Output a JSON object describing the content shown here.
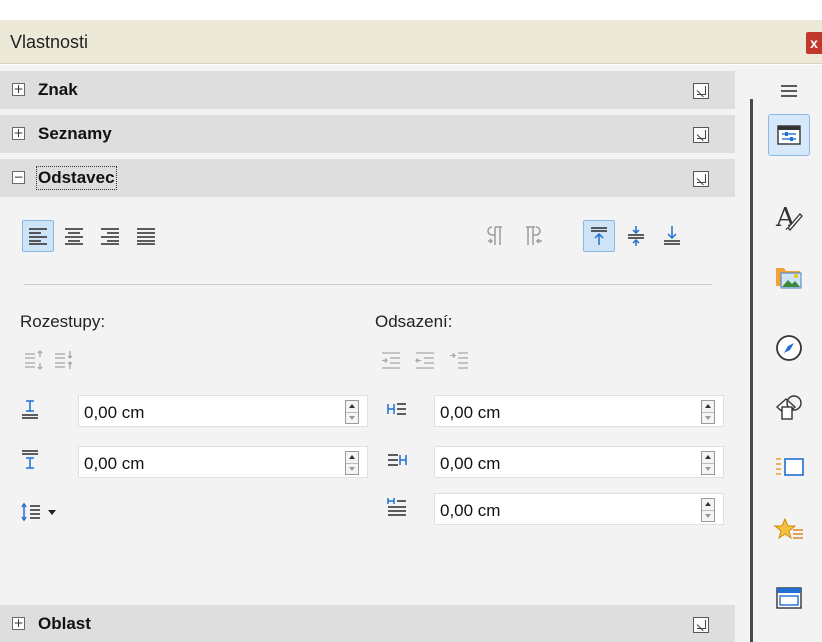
{
  "window": {
    "title": "Vlastnosti",
    "close_label": "x"
  },
  "sections": {
    "znak": {
      "label": "Znak",
      "expander": "+"
    },
    "seznamy": {
      "label": "Seznamy",
      "expander": "+"
    },
    "odstavec": {
      "label": "Odstavec",
      "expander": "−"
    },
    "oblast": {
      "label": "Oblast",
      "expander": "+"
    }
  },
  "paragraph": {
    "alignment": [
      "align-left",
      "align-center",
      "align-right",
      "align-justify"
    ],
    "selected_alignment": "align-left",
    "direction": [
      "ltr-paragraph",
      "rtl-paragraph"
    ],
    "vertical": [
      "align-top",
      "align-middle",
      "align-bottom"
    ],
    "selected_vertical": "align-top",
    "spacing": {
      "label": "Rozestupy:",
      "above": "0,00 cm",
      "below": "0,00 cm"
    },
    "indent": {
      "label": "Odsazení:",
      "before": "0,00 cm",
      "after": "0,00 cm",
      "first_line": "0,00 cm"
    }
  },
  "sidebar": {
    "menu_icon": "hamburger-menu-icon",
    "deck": [
      "properties",
      "styles",
      "gallery",
      "navigator",
      "shapes",
      "slide-layouts",
      "animation",
      "master-slides"
    ],
    "selected": "properties"
  },
  "colors": {
    "accent": "#1f6fd1",
    "active_bg": "#cfe3f7",
    "header_bg": "#dedede",
    "close_bg": "#c0392b"
  }
}
